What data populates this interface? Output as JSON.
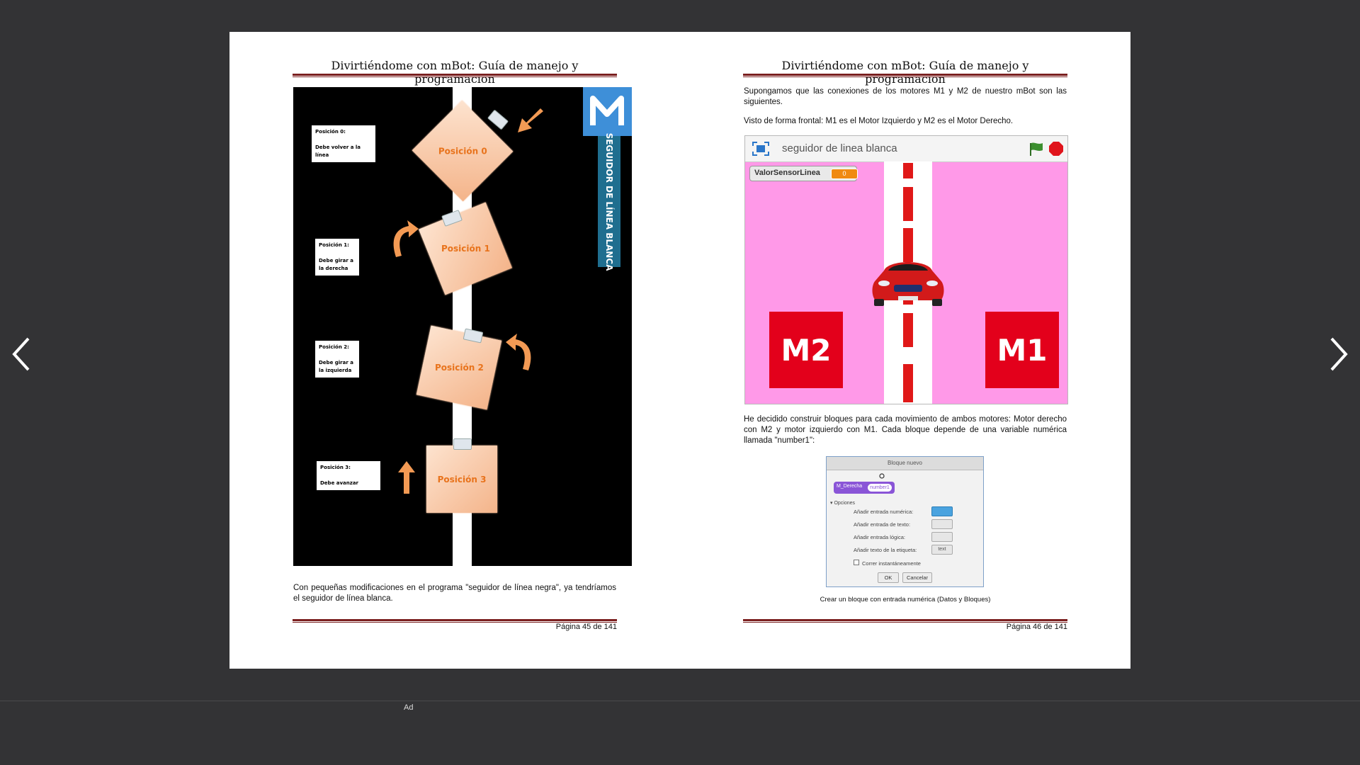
{
  "viewer": {
    "prev_icon": "chevron-left-icon",
    "next_icon": "chevron-right-icon",
    "ad_label": "Ad"
  },
  "left_page": {
    "header": "Divirtiéndome con mBot: Guía de manejo y programación",
    "figure": {
      "logo_text": "SEGUIDOR DE LÍNEA BLANCA",
      "positions": [
        {
          "card": "Posición 0",
          "note_title": "Posición 0:",
          "note_line1": "Debe volver a la línea",
          "note_line2": ""
        },
        {
          "card": "Posición 1",
          "note_title": "Posición 1:",
          "note_line1": "Debe girar a",
          "note_line2": "la derecha"
        },
        {
          "card": "Posición 2",
          "note_title": "Posición 2:",
          "note_line1": "Debe girar a",
          "note_line2": "la izquierda"
        },
        {
          "card": "Posición 3",
          "note_title": "Posición 3:",
          "note_line1": "Debe avanzar",
          "note_line2": ""
        }
      ]
    },
    "paragraph": "Con pequeñas modificaciones en el programa \"seguidor de línea negra\", ya tendríamos el seguidor de línea blanca.",
    "page_number": "Página 45 de 141"
  },
  "right_page": {
    "header": "Divirtiéndome con mBot: Guía de manejo y programación",
    "paragraph1": "Supongamos que las conexiones de los motores M1 y M2 de nuestro mBot son las siguientes.",
    "paragraph2": "Visto de forma frontal: M1 es el Motor Izquierdo y M2 es el Motor Derecho.",
    "scratch": {
      "project_title": "seguidor de linea blanca",
      "monitor_label": "ValorSensorLinea",
      "monitor_value": "0",
      "motor_left": "M2",
      "motor_right": "M1",
      "flag_color": "#3c8f2f",
      "stop_color": "#e0141c"
    },
    "paragraph3": "He decidido construir  bloques para cada movimiento de ambos motores: Motor derecho con M2 y motor izquierdo con M1. Cada bloque depende de una variable numérica llamada \"number1\":",
    "dialog": {
      "title": "Bloque nuevo",
      "block_name": "M_Derecha",
      "block_param": "number1",
      "options_label": "Opciones",
      "rows": [
        "Añadir entrada numérica:",
        "Añadir entrada de texto:",
        "Añadir entrada lógica:",
        "Añadir texto de la etiqueta:"
      ],
      "label_widget_text": "text",
      "run_instantly": "Correr instantáneamente",
      "ok": "OK",
      "cancel": "Cancelar"
    },
    "caption": "Crear un bloque con entrada numérica (Datos y Bloques)",
    "page_number": "Página 46 de 141"
  },
  "colors": {
    "rule": "#7a1f1f",
    "accent_orange": "#e8731c",
    "stage_pink": "#ff99e8",
    "motor_red": "#e3001b"
  }
}
